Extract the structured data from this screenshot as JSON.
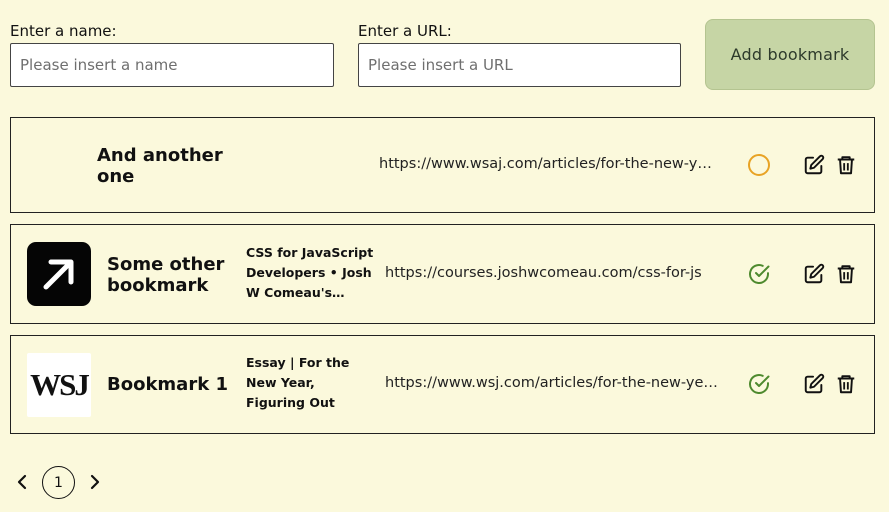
{
  "form": {
    "name_label": "Enter a name:",
    "name_placeholder": "Please insert a name",
    "name_value": "",
    "url_label": "Enter a URL:",
    "url_placeholder": "Please insert a URL",
    "url_value": "",
    "add_label": "Add bookmark"
  },
  "bookmarks": [
    {
      "name": "And another one",
      "description": "",
      "url": "https://www.wsaj.com/articles/for-the-new-year-figuring-out-what-matters-most",
      "thumbnail": "none",
      "status": "pending",
      "status_icon": "circle-icon",
      "status_color": "#e8a325"
    },
    {
      "name": "Some other bookmark",
      "description": "CSS for JavaScript Developers • Josh W Comeau's Course",
      "url": "https://courses.joshwcomeau.com/css-for-js",
      "thumbnail": "arrow-up-right-icon",
      "status": "valid",
      "status_icon": "check-circle-icon",
      "status_color": "#4e8a2e"
    },
    {
      "name": "Bookmark 1",
      "description": "Essay | For the New Year, Figuring Out What Matters Most",
      "url": "https://www.wsj.com/articles/for-the-new-year-figuring-out-what-matters-most",
      "thumbnail": "wsj-logo",
      "thumbnail_text": "WSJ",
      "status": "valid",
      "status_icon": "check-circle-icon",
      "status_color": "#4e8a2e"
    }
  ],
  "pagination": {
    "current_page": "1",
    "prev_icon": "chevron-left-icon",
    "next_icon": "chevron-right-icon"
  },
  "colors": {
    "background": "#fbf9dc",
    "button_bg": "#c6d5a5",
    "valid": "#4e8a2e",
    "pending": "#e8a325"
  }
}
